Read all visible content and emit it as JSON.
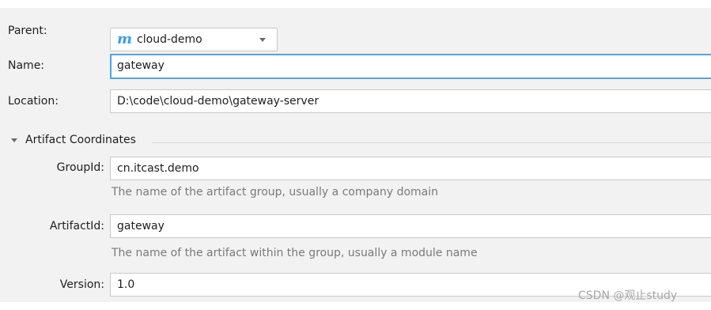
{
  "form": {
    "parent_label": "Parent:",
    "parent_value": "cloud-demo",
    "parent_icon": "m",
    "name_label": "Name:",
    "name_value": "gateway",
    "location_label": "Location:",
    "location_value": "D:\\code\\cloud-demo\\gateway-server"
  },
  "artifact": {
    "section_title": "Artifact Coordinates",
    "groupid_label": "GroupId:",
    "groupid_value": "cn.itcast.demo",
    "groupid_hint": "The name of the artifact group, usually a company domain",
    "artifactid_label": "ArtifactId:",
    "artifactid_value": "gateway",
    "artifactid_hint": "The name of the artifact within the group, usually a module name",
    "version_label": "Version:",
    "version_value": "1.0"
  },
  "watermark": "CSDN @观止study",
  "colors": {
    "accent": "#3d9be9",
    "focus": "#5aa0de",
    "panel": "#f2f2f2"
  }
}
